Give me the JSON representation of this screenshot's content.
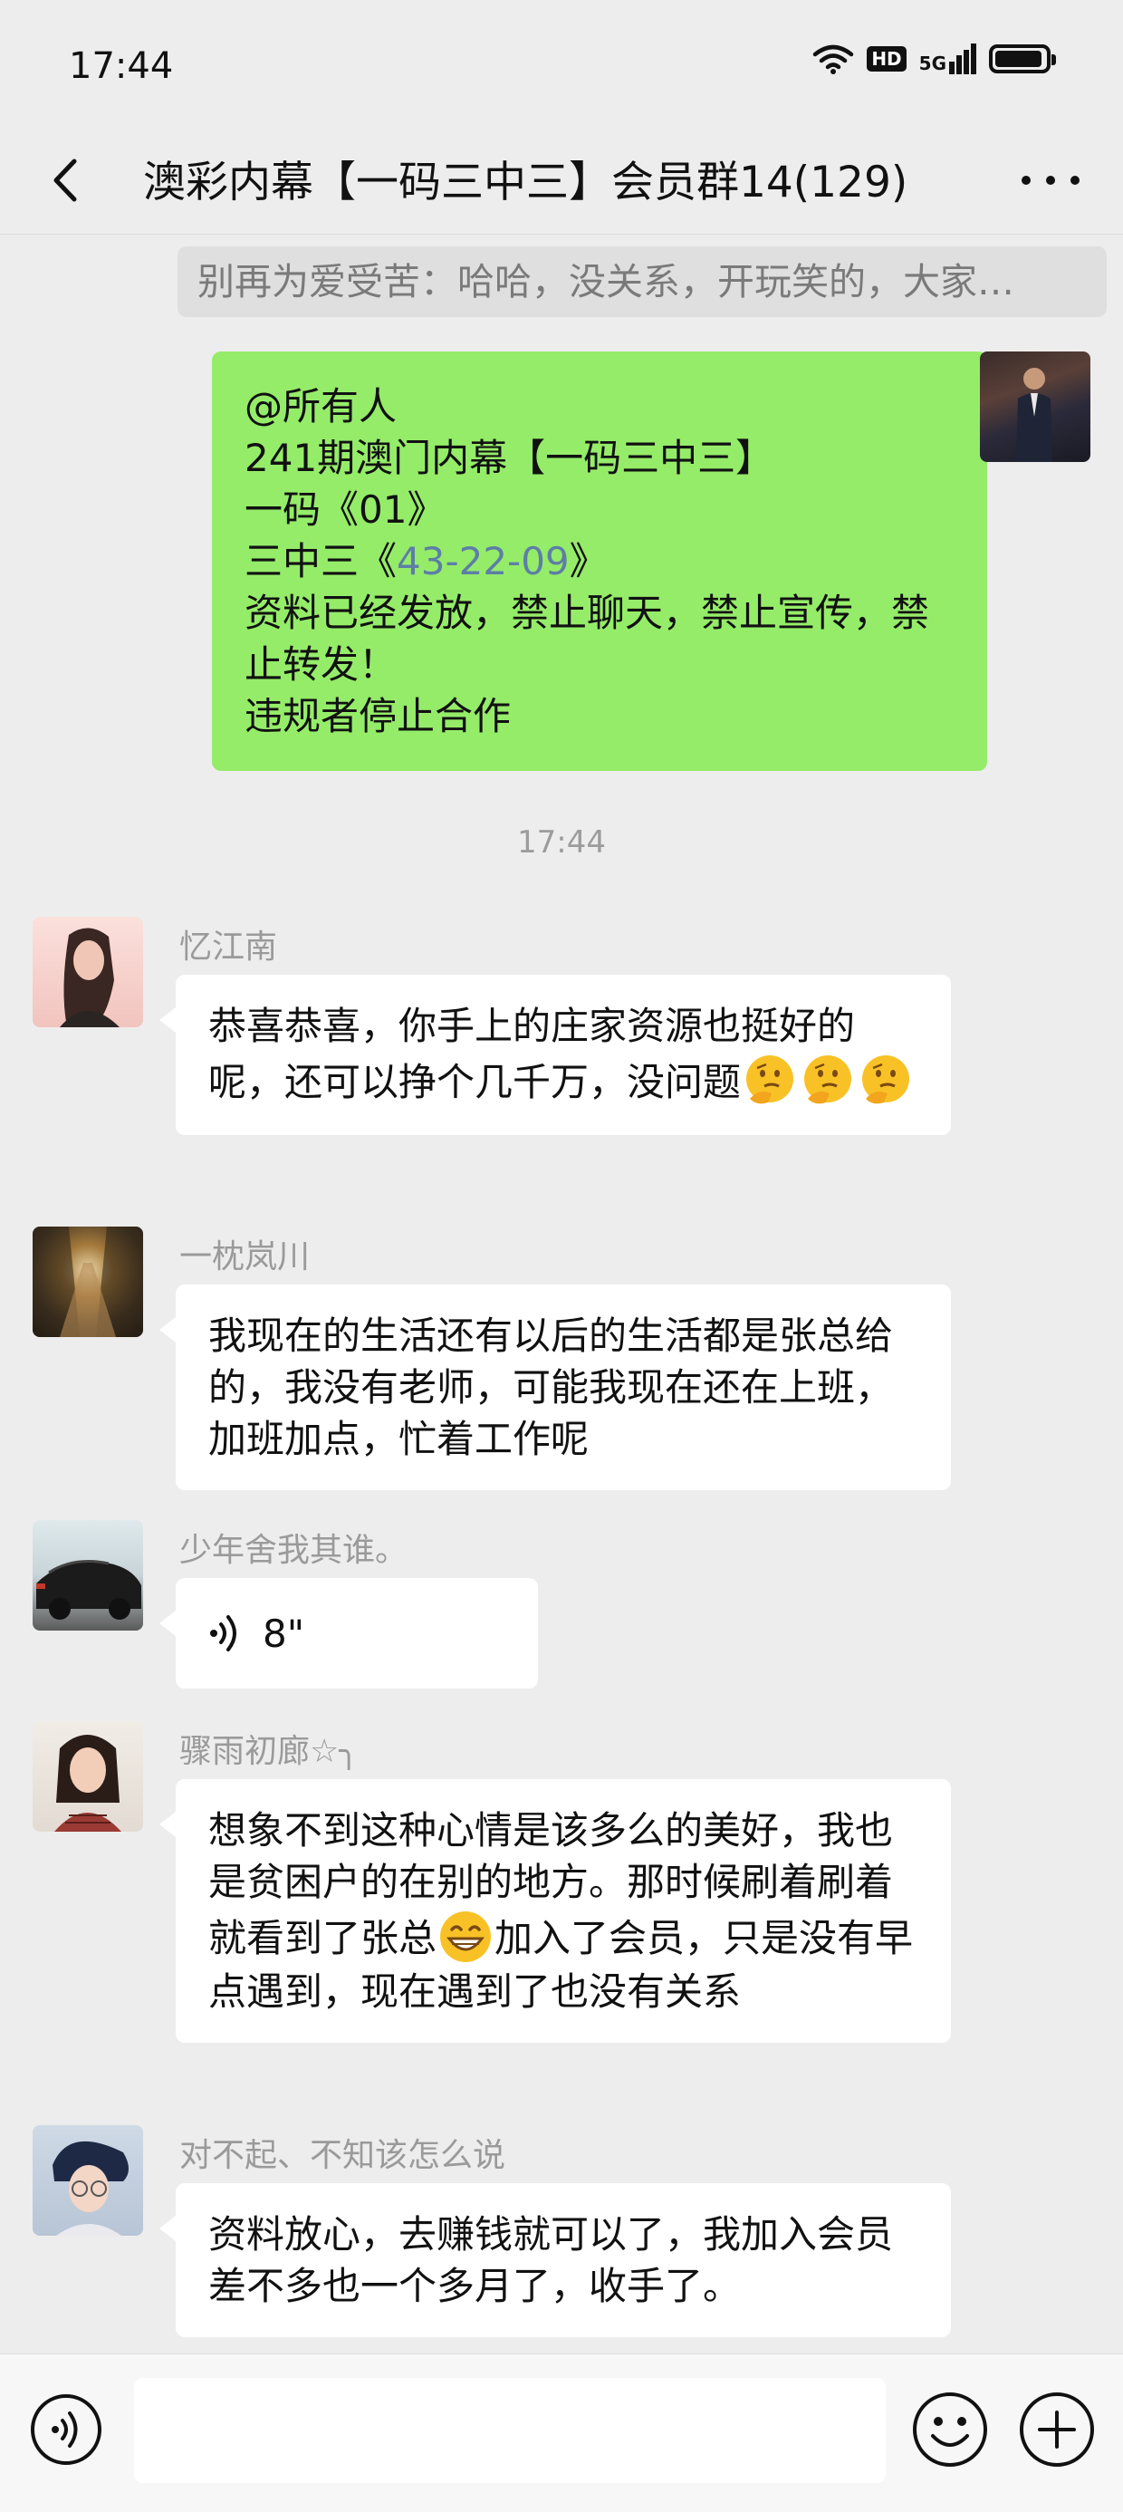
{
  "status_bar": {
    "time": "17:44",
    "hd": "HD",
    "network": "5G",
    "battery_level": 0.85,
    "icons": [
      "wifi-icon",
      "hd-icon",
      "signal-5g-icon",
      "battery-icon"
    ]
  },
  "nav": {
    "title": "澳彩内幕【一码三中三】会员群14(129)",
    "icons": [
      "back-icon",
      "more-icon"
    ]
  },
  "chat": {
    "notice": "别再为爱受苦：哈哈，没关系，开玩笑的，大家…",
    "outgoing": {
      "lines": [
        "@所有人",
        "241期澳门内幕【一码三中三】",
        "一码《01》"
      ],
      "line4_prefix": "三中三《",
      "line4_numbers": "43-22-09",
      "line4_suffix": "》",
      "lines_after": [
        "资料已经发放，禁止聊天，禁止宣传，禁止转发！",
        "违规者停止合作"
      ]
    },
    "timestamp": "17:44",
    "messages": [
      {
        "sender": "忆江南",
        "text": "恭喜恭喜，你手上的庄家资源也挺好的呢，还可以挣个几千万，没问题",
        "emoji": "thinking-face-emoji"
      },
      {
        "sender": "一枕岚川",
        "text": "我现在的生活还有以后的生活都是张总给的，我没有老师，可能我现在还在上班，加班加点，忙着工作呢"
      },
      {
        "sender": "少年舍我其谁。",
        "voice_duration": "8\""
      },
      {
        "sender": "骤雨初廊☆╮",
        "text_before": "想象不到这种心情是该多么的美好，我也是贫困户的在别的地方。那时候刷着刷着就看到了张总",
        "emoji": "grinning-face-emoji",
        "text_after": "加入了会员，只是没有早点遇到，现在遇到了也没有关系"
      },
      {
        "sender": "对不起、不知该怎么说",
        "text": "资料放心，去赚钱就可以了，我加入会员差不多也一个多月了，收手了。"
      }
    ]
  },
  "input_bar": {
    "icons": [
      "voice-input-icon",
      "emoji-icon",
      "plus-icon"
    ],
    "value": ""
  }
}
